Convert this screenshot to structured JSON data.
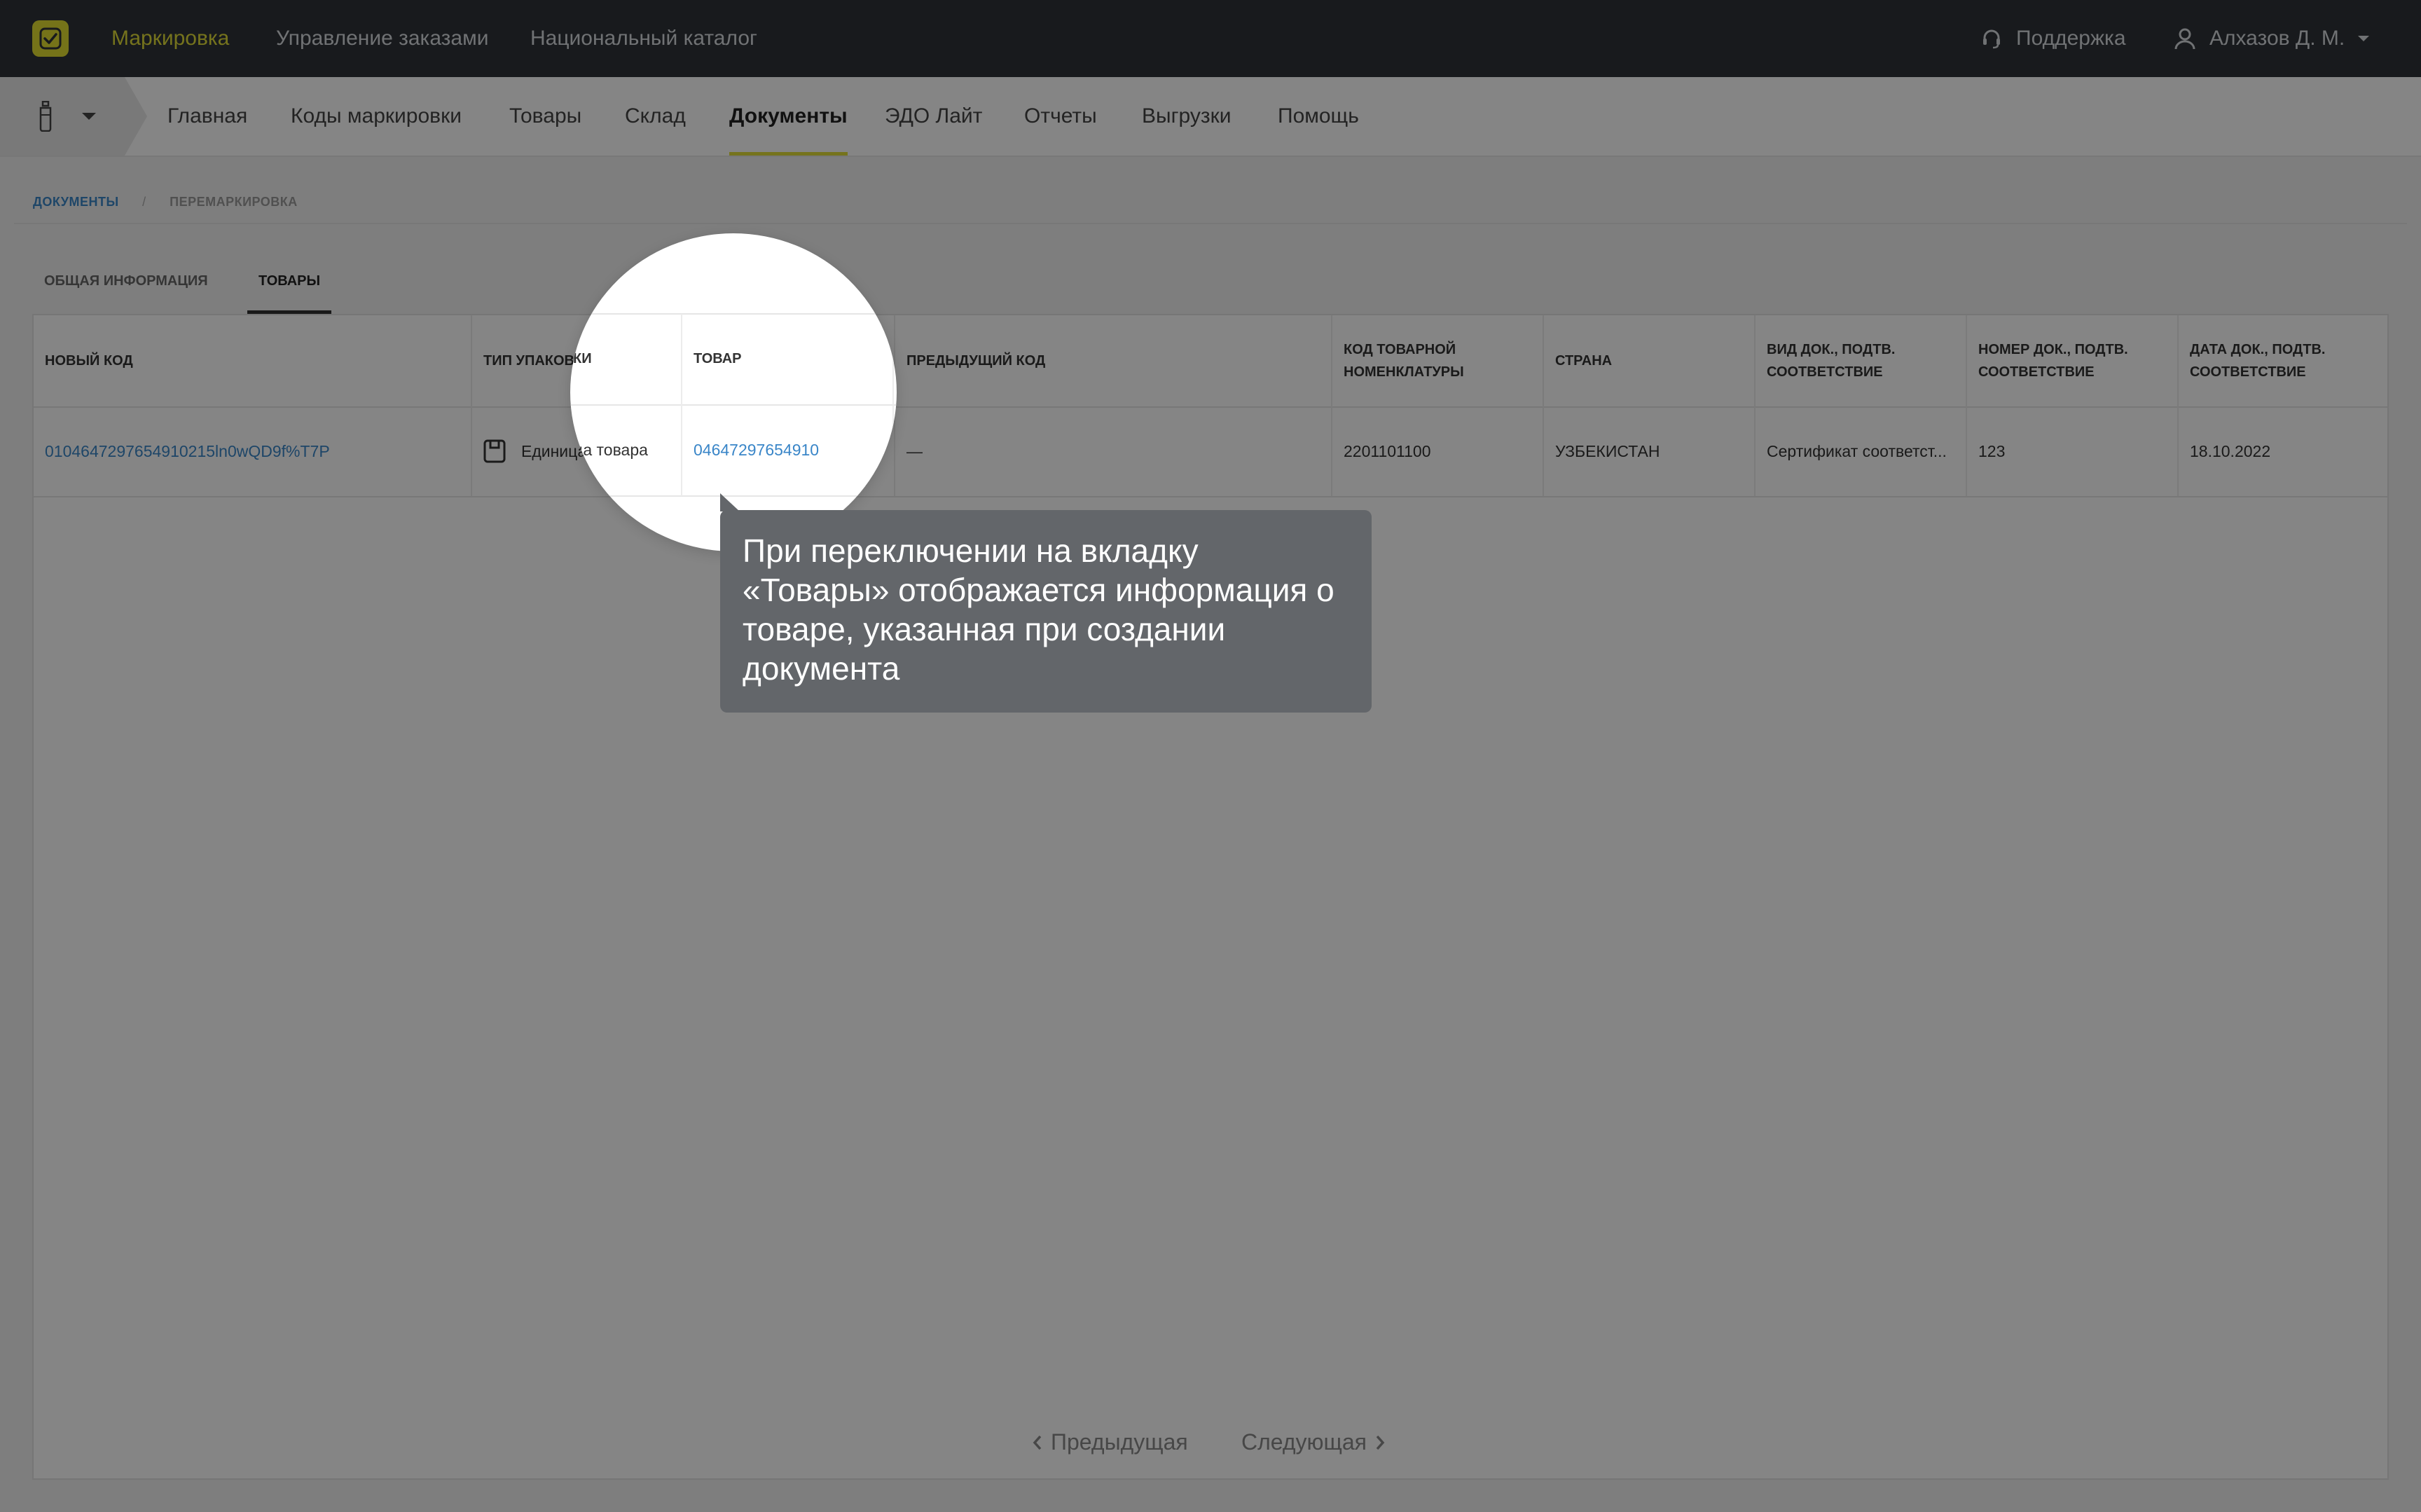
{
  "topbar": {
    "nav": [
      "Маркировка",
      "Управление заказами",
      "Национальный каталог"
    ],
    "support_label": "Поддержка",
    "user_name": "Алхазов Д. М."
  },
  "subnav": {
    "items": [
      "Главная",
      "Коды маркировки",
      "Товары",
      "Склад",
      "Документы",
      "ЭДО Лайт",
      "Отчеты",
      "Выгрузки",
      "Помощь"
    ],
    "active": "Документы"
  },
  "breadcrumb": {
    "root": "Документы",
    "current": "Перемаркировка"
  },
  "tabs": {
    "general": "Общая информация",
    "goods": "Товары"
  },
  "table": {
    "headers": {
      "new_code": "Новый код",
      "pack_type": "Тип упаковки",
      "product": "Товар",
      "prev_code": "Предыдущий код",
      "tnved": "Код товарной номенклатуры",
      "country": "Страна",
      "doc_type": "Вид док., подтв. соответствие",
      "doc_number": "Номер док., подтв. соответствие",
      "doc_date": "Дата док., подтв. соответствие"
    },
    "rows": [
      {
        "new_code": "0104647297654910215ln0wQD9f%T7P",
        "pack_type": "Единица товара",
        "product": "04647297654910",
        "prev_code": "—",
        "tnved": "2201101100",
        "country": "УЗБЕКИСТАН",
        "doc_type": "Сертификат соответст...",
        "doc_number": "123",
        "doc_date": "18.10.2022"
      }
    ]
  },
  "pager": {
    "prev": "Предыдущая",
    "next": "Следующая"
  },
  "tooltip": {
    "text": "При переключении на вкладку «Товары» отображается информация о товаре, указанная при создании документа"
  },
  "colors": {
    "topbar": "#2e3338",
    "accent": "#e1dd38",
    "link": "#3a86c8",
    "tooltip": "#63666a"
  }
}
